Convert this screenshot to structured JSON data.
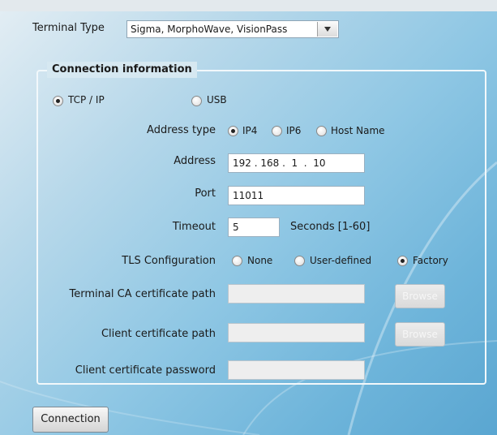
{
  "terminal_type": {
    "label": "Terminal Type",
    "selected": "Sigma, MorphoWave, VisionPass"
  },
  "connection_info": {
    "title": "Connection information",
    "tcp_ip_label": "TCP / IP",
    "usb_label": "USB",
    "address_type": {
      "label": "Address type",
      "ip4": "IP4",
      "ip6": "IP6",
      "host": "Host Name",
      "selected": "IP4"
    },
    "address": {
      "label": "Address",
      "value": "192 . 168 .  1  .  10"
    },
    "port": {
      "label": "Port",
      "value": "11011"
    },
    "timeout": {
      "label": "Timeout",
      "value": "5",
      "unit": "Seconds [1-60]"
    },
    "tls": {
      "label": "TLS Configuration",
      "none": "None",
      "user_defined": "User-defined",
      "factory": "Factory",
      "selected": "Factory"
    },
    "terminal_ca": {
      "label": "Terminal CA certificate path",
      "browse": "Browse"
    },
    "client_cert": {
      "label": "Client certificate path",
      "browse": "Browse"
    },
    "client_password": {
      "label": "Client certificate password"
    }
  },
  "connection_button": "Connection"
}
